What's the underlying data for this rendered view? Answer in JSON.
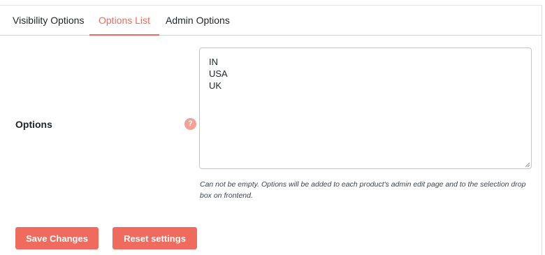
{
  "tabs": [
    {
      "label": "Visibility Options",
      "active": false
    },
    {
      "label": "Options List",
      "active": true
    },
    {
      "label": "Admin Options",
      "active": false
    }
  ],
  "options_field": {
    "label": "Options",
    "help_icon": "question-mark-icon",
    "value": "IN\nUSA\nUK",
    "description": "Can not be empty. Options will be added to each product's admin edit page and to the selection drop box on frontend."
  },
  "actions": {
    "save_label": "Save Changes",
    "reset_label": "Reset settings"
  },
  "colors": {
    "accent": "#ee6b5c",
    "help_icon": "#f2a197",
    "text": "#1d2327"
  }
}
